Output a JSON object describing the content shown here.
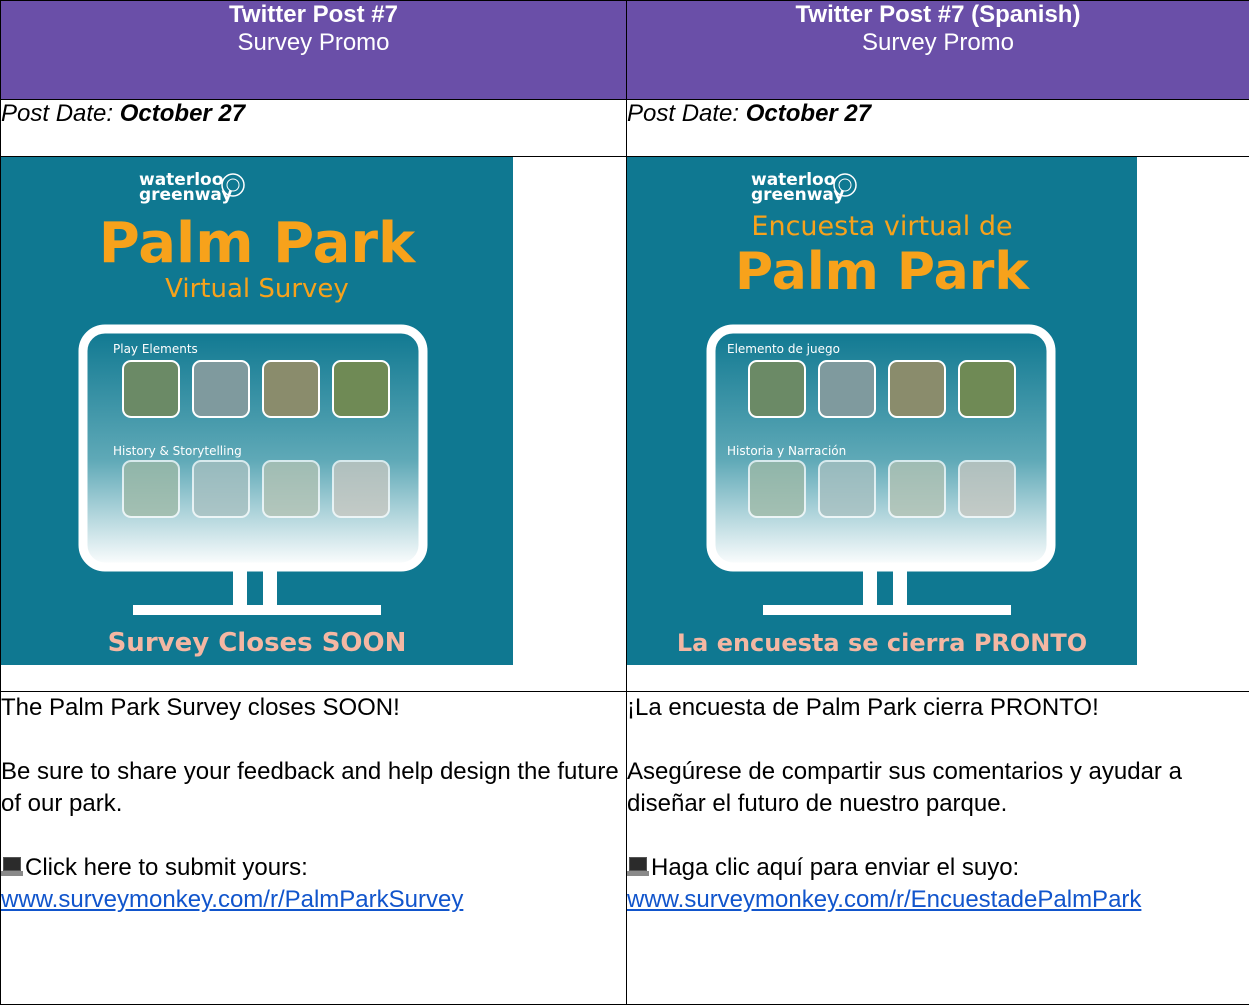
{
  "left": {
    "header_title": "Twitter Post #7",
    "header_sub": "Survey Promo",
    "date_label": "Post Date: ",
    "date_value": "October 27",
    "poster": {
      "brand_line1": "waterloo",
      "brand_line2": "greenway",
      "title_line1": "Palm Park",
      "title_line2": "Virtual Survey",
      "section1": "Play Elements",
      "section2": "History & Storytelling",
      "footer": "Survey Closes SOON"
    },
    "body_p1": "The Palm Park Survey closes SOON!",
    "body_p2": "Be sure to share your feedback and help design the future of our park.",
    "body_p3": "Click here to submit yours:",
    "link": "www.surveymonkey.com/r/PalmParkSurvey"
  },
  "right": {
    "header_title": "Twitter Post #7 (Spanish)",
    "header_sub": "Survey Promo",
    "date_label": "Post Date: ",
    "date_value": "October 27",
    "poster": {
      "brand_line1": "waterloo",
      "brand_line2": "greenway",
      "title_line1": "Encuesta virtual de",
      "title_line2": "Palm Park",
      "section1": "Elemento de juego",
      "section2": "Historia y Narración",
      "footer": "La encuesta se cierra PRONTO"
    },
    "body_p1": "¡La encuesta de Palm Park cierra PRONTO!",
    "body_p2": "Asegúrese de compartir sus comentarios y ayudar a diseñar el futuro de nuestro parque.",
    "body_p3": "Haga clic aquí para enviar el suyo:",
    "link": "www.surveymonkey.com/r/EncuestadePalmPark"
  },
  "colors": {
    "header_bg": "#6a4fa8",
    "poster_bg": "#0f7891",
    "poster_title": "#f7a21b",
    "poster_footer": "#f4b7a3",
    "link": "#1155cc"
  },
  "icons": [
    "laptop-icon",
    "seal-icon"
  ]
}
